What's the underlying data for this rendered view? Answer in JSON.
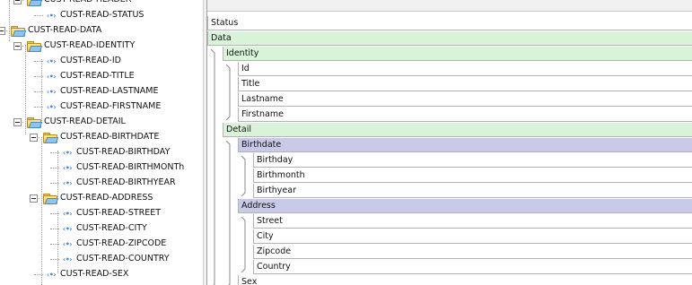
{
  "tree": {
    "items": [
      {
        "label": "CUST-READ-HEADER",
        "kind": "folder",
        "depth": 1
      },
      {
        "label": "CUST-READ-STATUS",
        "kind": "leaf",
        "depth": 2
      },
      {
        "label": "CUST-READ-DATA",
        "kind": "folder",
        "depth": 0
      },
      {
        "label": "CUST-READ-IDENTITY",
        "kind": "folder",
        "depth": 1
      },
      {
        "label": "CUST-READ-ID",
        "kind": "leaf",
        "depth": 2
      },
      {
        "label": "CUST-READ-TITLE",
        "kind": "leaf",
        "depth": 2
      },
      {
        "label": "CUST-READ-LASTNAME",
        "kind": "leaf",
        "depth": 2
      },
      {
        "label": "CUST-READ-FIRSTNAME",
        "kind": "leaf",
        "depth": 2
      },
      {
        "label": "CUST-READ-DETAIL",
        "kind": "folder",
        "depth": 1
      },
      {
        "label": "CUST-READ-BIRTHDATE",
        "kind": "folder",
        "depth": 2
      },
      {
        "label": "CUST-READ-BIRTHDAY",
        "kind": "leaf",
        "depth": 3
      },
      {
        "label": "CUST-READ-BIRTHMONTh",
        "kind": "leaf",
        "depth": 3
      },
      {
        "label": "CUST-READ-BIRTHYEAR",
        "kind": "leaf",
        "depth": 3
      },
      {
        "label": "CUST-READ-ADDRESS",
        "kind": "folder",
        "depth": 2
      },
      {
        "label": "CUST-READ-STREET",
        "kind": "leaf",
        "depth": 3
      },
      {
        "label": "CUST-READ-CITY",
        "kind": "leaf",
        "depth": 3
      },
      {
        "label": "CUST-READ-ZIPCODE",
        "kind": "leaf",
        "depth": 3
      },
      {
        "label": "CUST-READ-COUNTRY",
        "kind": "leaf",
        "depth": 3
      },
      {
        "label": "CUST-READ-SEX",
        "kind": "leaf",
        "depth": 2
      }
    ],
    "leaf_glyph": "‹•›"
  },
  "grid": {
    "rows": [
      {
        "label": "Status",
        "color": "white",
        "level": 0
      },
      {
        "label": "Data",
        "color": "green",
        "level": 0
      },
      {
        "label": "Identity",
        "color": "green",
        "level": 1
      },
      {
        "label": "Id",
        "color": "white",
        "level": 2
      },
      {
        "label": "Title",
        "color": "white",
        "level": 2
      },
      {
        "label": "Lastname",
        "color": "white",
        "level": 2
      },
      {
        "label": "Firstname",
        "color": "white",
        "level": 2
      },
      {
        "label": "Detail",
        "color": "green",
        "level": 1
      },
      {
        "label": "Birthdate",
        "color": "purple",
        "level": 2
      },
      {
        "label": "Birthday",
        "color": "white",
        "level": 3
      },
      {
        "label": "Birthmonth",
        "color": "white",
        "level": 3
      },
      {
        "label": "Birthyear",
        "color": "white",
        "level": 3
      },
      {
        "label": "Address",
        "color": "purple",
        "level": 2
      },
      {
        "label": "Street",
        "color": "white",
        "level": 3
      },
      {
        "label": "City",
        "color": "white",
        "level": 3
      },
      {
        "label": "Zipcode",
        "color": "white",
        "level": 3
      },
      {
        "label": "Country",
        "color": "white",
        "level": 3
      },
      {
        "label": "Sex",
        "color": "white",
        "level": 2
      }
    ]
  },
  "colors": {
    "green_row": "#d9f3d9",
    "purple_row": "#c7c9e6",
    "leaf_icon": "#4e86d6",
    "folder": "#f3c94a"
  }
}
